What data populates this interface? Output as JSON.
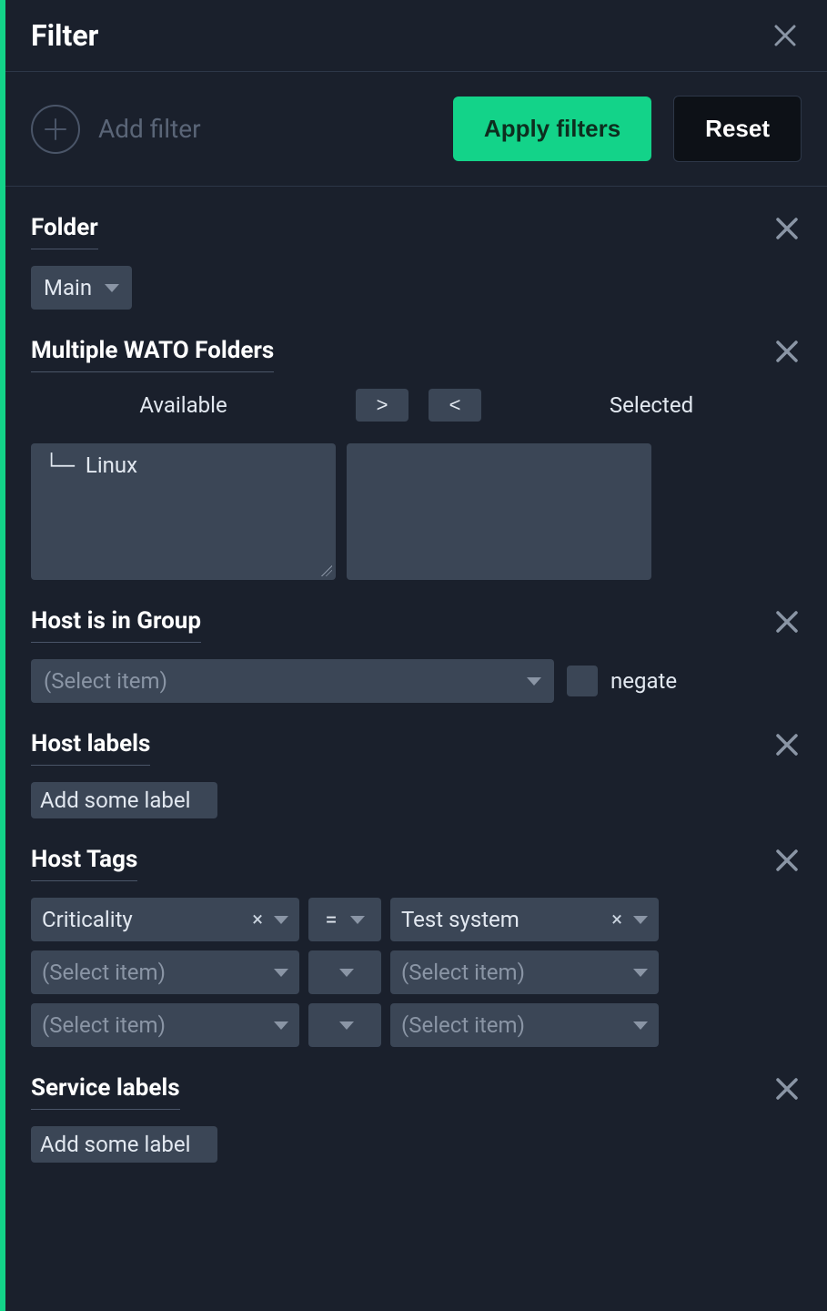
{
  "header": {
    "title": "Filter"
  },
  "toolbar": {
    "add_filter_label": "Add filter",
    "apply_label": "Apply filters",
    "reset_label": "Reset"
  },
  "sections": {
    "folder": {
      "title": "Folder",
      "selected": "Main"
    },
    "multi_folders": {
      "title": "Multiple WATO Folders",
      "available_label": "Available",
      "selected_label": "Selected",
      "move_right": ">",
      "move_left": "<",
      "available_items": [
        "└─  Linux"
      ],
      "selected_items": []
    },
    "host_group": {
      "title": "Host is in Group",
      "placeholder": "(Select item)",
      "negate_label": "negate"
    },
    "host_labels": {
      "title": "Host labels",
      "add_label_text": "Add some label"
    },
    "host_tags": {
      "title": "Host Tags",
      "rows": [
        {
          "group": "Criticality",
          "op": "=",
          "value": "Test system",
          "filled": true
        },
        {
          "group": "(Select item)",
          "op": "",
          "value": "(Select item)",
          "filled": false
        },
        {
          "group": "(Select item)",
          "op": "",
          "value": "(Select item)",
          "filled": false
        }
      ]
    },
    "service_labels": {
      "title": "Service labels",
      "add_label_text": "Add some label"
    }
  }
}
